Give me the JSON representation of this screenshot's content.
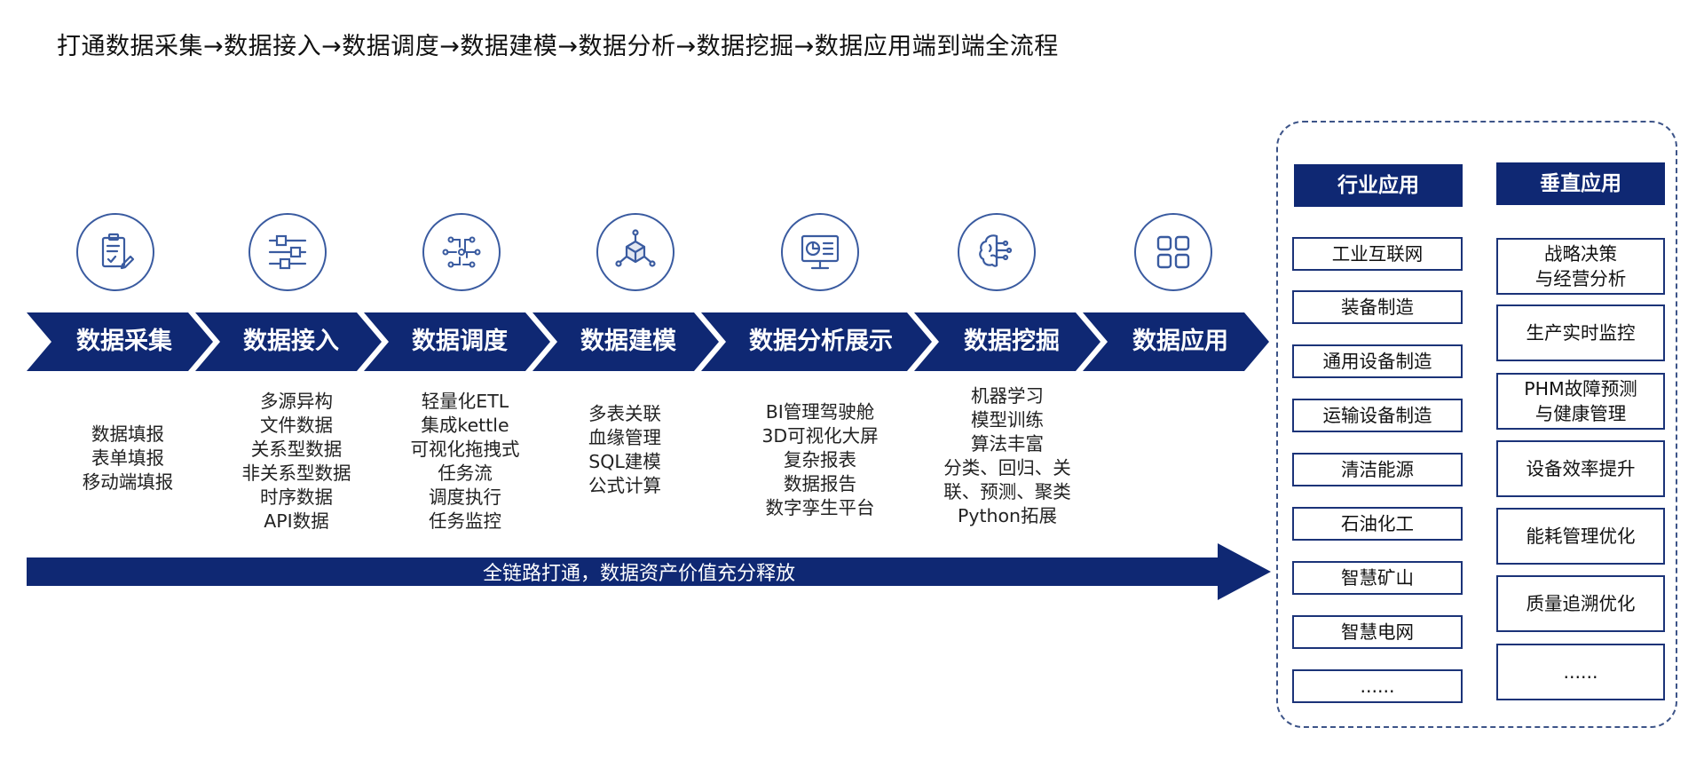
{
  "title": "打通数据采集→数据接入→数据调度→数据建模→数据分析→数据挖掘→数据应用端到端全流程",
  "colors": {
    "navy": "#0f2873",
    "icon_stroke": "#3a5ba0",
    "frame": "#3d5488"
  },
  "stages": [
    {
      "label": "数据采集",
      "icon": "clipboard-pen-icon",
      "items": [
        "数据填报",
        "表单填报",
        "移动端填报"
      ]
    },
    {
      "label": "数据接入",
      "icon": "sliders-icon",
      "items": [
        "多源异构",
        "文件数据",
        "关系型数据",
        "非关系型数据",
        "时序数据",
        "API数据"
      ]
    },
    {
      "label": "数据调度",
      "icon": "circuit-nodes-icon",
      "items": [
        "轻量化ETL",
        "集成kettle",
        "可视化拖拽式",
        "任务流",
        "调度执行",
        "任务监控"
      ]
    },
    {
      "label": "数据建模",
      "icon": "cube-network-icon",
      "items": [
        "多表关联",
        "血缘管理",
        "SQL建模",
        "公式计算"
      ]
    },
    {
      "label": "数据分析展示",
      "icon": "monitor-chart-icon",
      "items": [
        "BI管理驾驶舱",
        "3D可视化大屏",
        "复杂报表",
        "数据报告",
        "数字孪生平台"
      ]
    },
    {
      "label": "数据挖掘",
      "icon": "brain-circuit-icon",
      "items": [
        "机器学习",
        "模型训练",
        "算法丰富",
        "分类、回归、关",
        "联、预测、聚类",
        "Python拓展"
      ]
    },
    {
      "label": "数据应用",
      "icon": "app-grid-icon",
      "items": []
    }
  ],
  "banner": "全链路打通，数据资产价值充分释放",
  "industry": {
    "header": "行业应用",
    "items": [
      "工业互联网",
      "装备制造",
      "通用设备制造",
      "运输设备制造",
      "清洁能源",
      "石油化工",
      "智慧矿山",
      "智慧电网",
      "......"
    ]
  },
  "vertical": {
    "header": "垂直应用",
    "items": [
      "战略决策\n与经营分析",
      "生产实时监控",
      "PHM故障预测\n与健康管理",
      "设备效率提升",
      "能耗管理优化",
      "质量追溯优化",
      "......"
    ]
  }
}
